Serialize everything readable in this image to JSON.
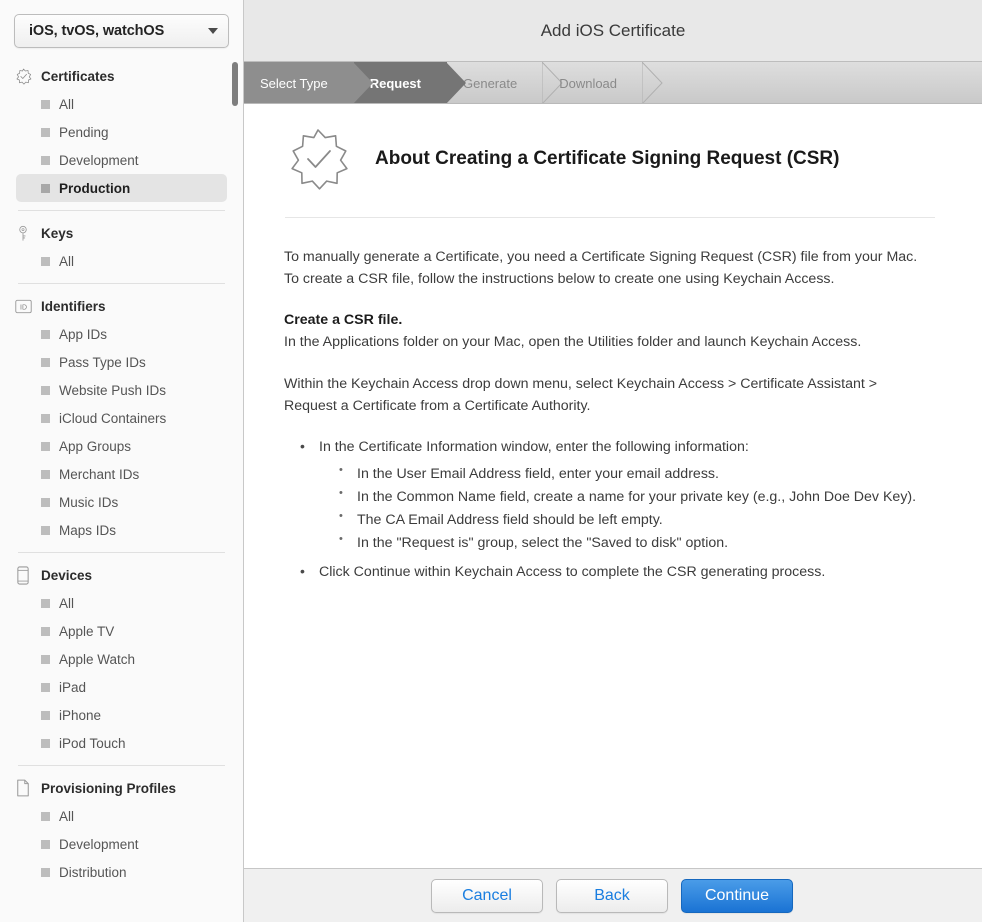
{
  "sidebar": {
    "platform_select": {
      "value": "iOS, tvOS, watchOS",
      "caret_icon": "chevron-down-icon"
    },
    "sections": [
      {
        "title": "Certificates",
        "icon": "certificate-seal-icon",
        "items": [
          {
            "label": "All",
            "selected": false
          },
          {
            "label": "Pending",
            "selected": false
          },
          {
            "label": "Development",
            "selected": false
          },
          {
            "label": "Production",
            "selected": true
          }
        ]
      },
      {
        "title": "Keys",
        "icon": "key-icon",
        "items": [
          {
            "label": "All",
            "selected": false
          }
        ]
      },
      {
        "title": "Identifiers",
        "icon": "id-badge-icon",
        "items": [
          {
            "label": "App IDs",
            "selected": false
          },
          {
            "label": "Pass Type IDs",
            "selected": false
          },
          {
            "label": "Website Push IDs",
            "selected": false
          },
          {
            "label": "iCloud Containers",
            "selected": false
          },
          {
            "label": "App Groups",
            "selected": false
          },
          {
            "label": "Merchant IDs",
            "selected": false
          },
          {
            "label": "Music IDs",
            "selected": false
          },
          {
            "label": "Maps IDs",
            "selected": false
          }
        ]
      },
      {
        "title": "Devices",
        "icon": "phone-icon",
        "items": [
          {
            "label": "All",
            "selected": false
          },
          {
            "label": "Apple TV",
            "selected": false
          },
          {
            "label": "Apple Watch",
            "selected": false
          },
          {
            "label": "iPad",
            "selected": false
          },
          {
            "label": "iPhone",
            "selected": false
          },
          {
            "label": "iPod Touch",
            "selected": false
          }
        ]
      },
      {
        "title": "Provisioning Profiles",
        "icon": "document-icon",
        "items": [
          {
            "label": "All",
            "selected": false
          },
          {
            "label": "Development",
            "selected": false
          },
          {
            "label": "Distribution",
            "selected": false
          }
        ]
      }
    ]
  },
  "header": {
    "title": "Add iOS Certificate"
  },
  "steps": [
    {
      "label": "Select Type",
      "state": "done"
    },
    {
      "label": "Request",
      "state": "active"
    },
    {
      "label": "Generate",
      "state": "todo"
    },
    {
      "label": "Download",
      "state": "todo"
    }
  ],
  "content": {
    "icon": "certificate-seal-check-icon",
    "title": "About Creating a Certificate Signing Request (CSR)",
    "intro": "To manually generate a Certificate, you need a Certificate Signing Request (CSR) file from your Mac. To create a CSR file, follow the instructions below to create one using Keychain Access.",
    "create_heading": "Create a CSR file.",
    "create_line": "In the Applications folder on your Mac, open the Utilities folder and launch Keychain Access.",
    "menu_line": "Within the Keychain Access drop down menu, select Keychain Access > Certificate Assistant > Request a Certificate from a Certificate Authority.",
    "bullet_1": "In the Certificate Information window, enter the following information:",
    "sub_bullets": [
      "In the User Email Address field, enter your email address.",
      "In the Common Name field, create a name for your private key (e.g., John Doe Dev Key).",
      "The CA Email Address field should be left empty.",
      "In the \"Request is\" group, select the \"Saved to disk\" option."
    ],
    "bullet_2": "Click Continue within Keychain Access to complete the CSR generating process."
  },
  "footer": {
    "cancel_label": "Cancel",
    "back_label": "Back",
    "continue_label": "Continue"
  },
  "colors": {
    "primary_button": "#1a73d4",
    "link_text": "#1a7ee0",
    "step_active": "#757575",
    "step_done": "#8e8e8e",
    "sidebar_selected": "#e4e4e4"
  }
}
